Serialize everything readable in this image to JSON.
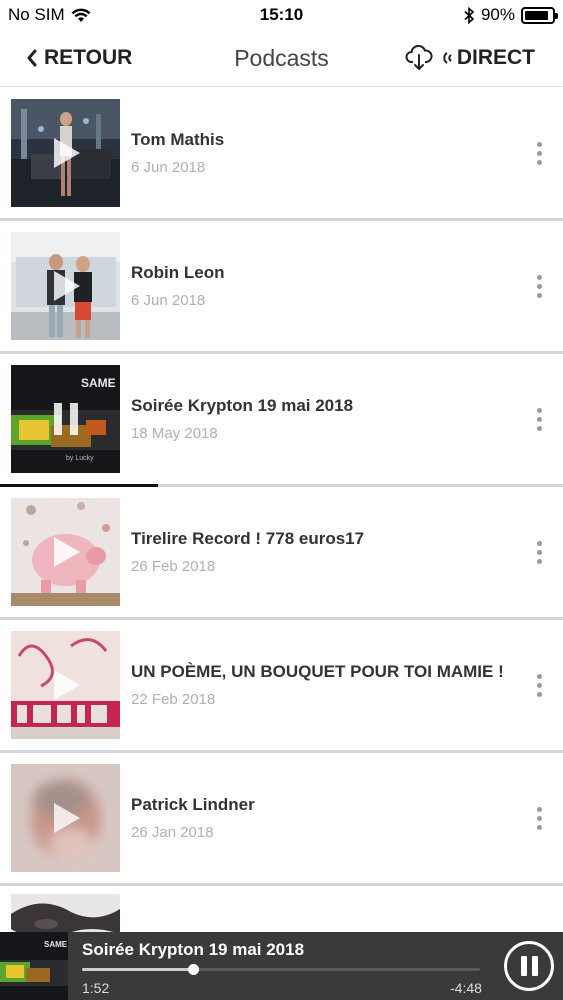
{
  "status_bar": {
    "carrier": "No SIM",
    "time": "15:10",
    "battery_percent": "90%",
    "battery_level": 0.9
  },
  "nav": {
    "back_label": "RETOUR",
    "title": "Podcasts",
    "direct_label": "DIRECT"
  },
  "podcasts": [
    {
      "title": "Tom Mathis",
      "date": "6 Jun 2018",
      "state": "play",
      "thumb_icon": "concert-stage-thumbnail"
    },
    {
      "title": "Robin Leon",
      "date": "6 Jun 2018",
      "state": "play",
      "thumb_icon": "two-men-photo-thumbnail"
    },
    {
      "title": "Soirée Krypton 19 mai 2018",
      "date": "18 May 2018",
      "state": "pause",
      "progress": 0.28,
      "thumb_icon": "party-flyer-thumbnail"
    },
    {
      "title": "Tirelire Record ! 778 euros17",
      "date": "26 Feb 2018",
      "state": "play",
      "thumb_icon": "piggy-bank-thumbnail"
    },
    {
      "title": "UN POÈME, UN BOUQUET POUR TOI MAMIE !",
      "date": "22 Feb 2018",
      "state": "play",
      "thumb_icon": "mamie-card-thumbnail"
    },
    {
      "title": "Patrick Lindner",
      "date": "26 Jan 2018",
      "state": "play",
      "thumb_icon": "portrait-blur-thumbnail"
    }
  ],
  "player": {
    "title": "Soirée Krypton 19 mai 2018",
    "elapsed": "1:52",
    "remaining": "-4:48",
    "progress": 0.28
  }
}
